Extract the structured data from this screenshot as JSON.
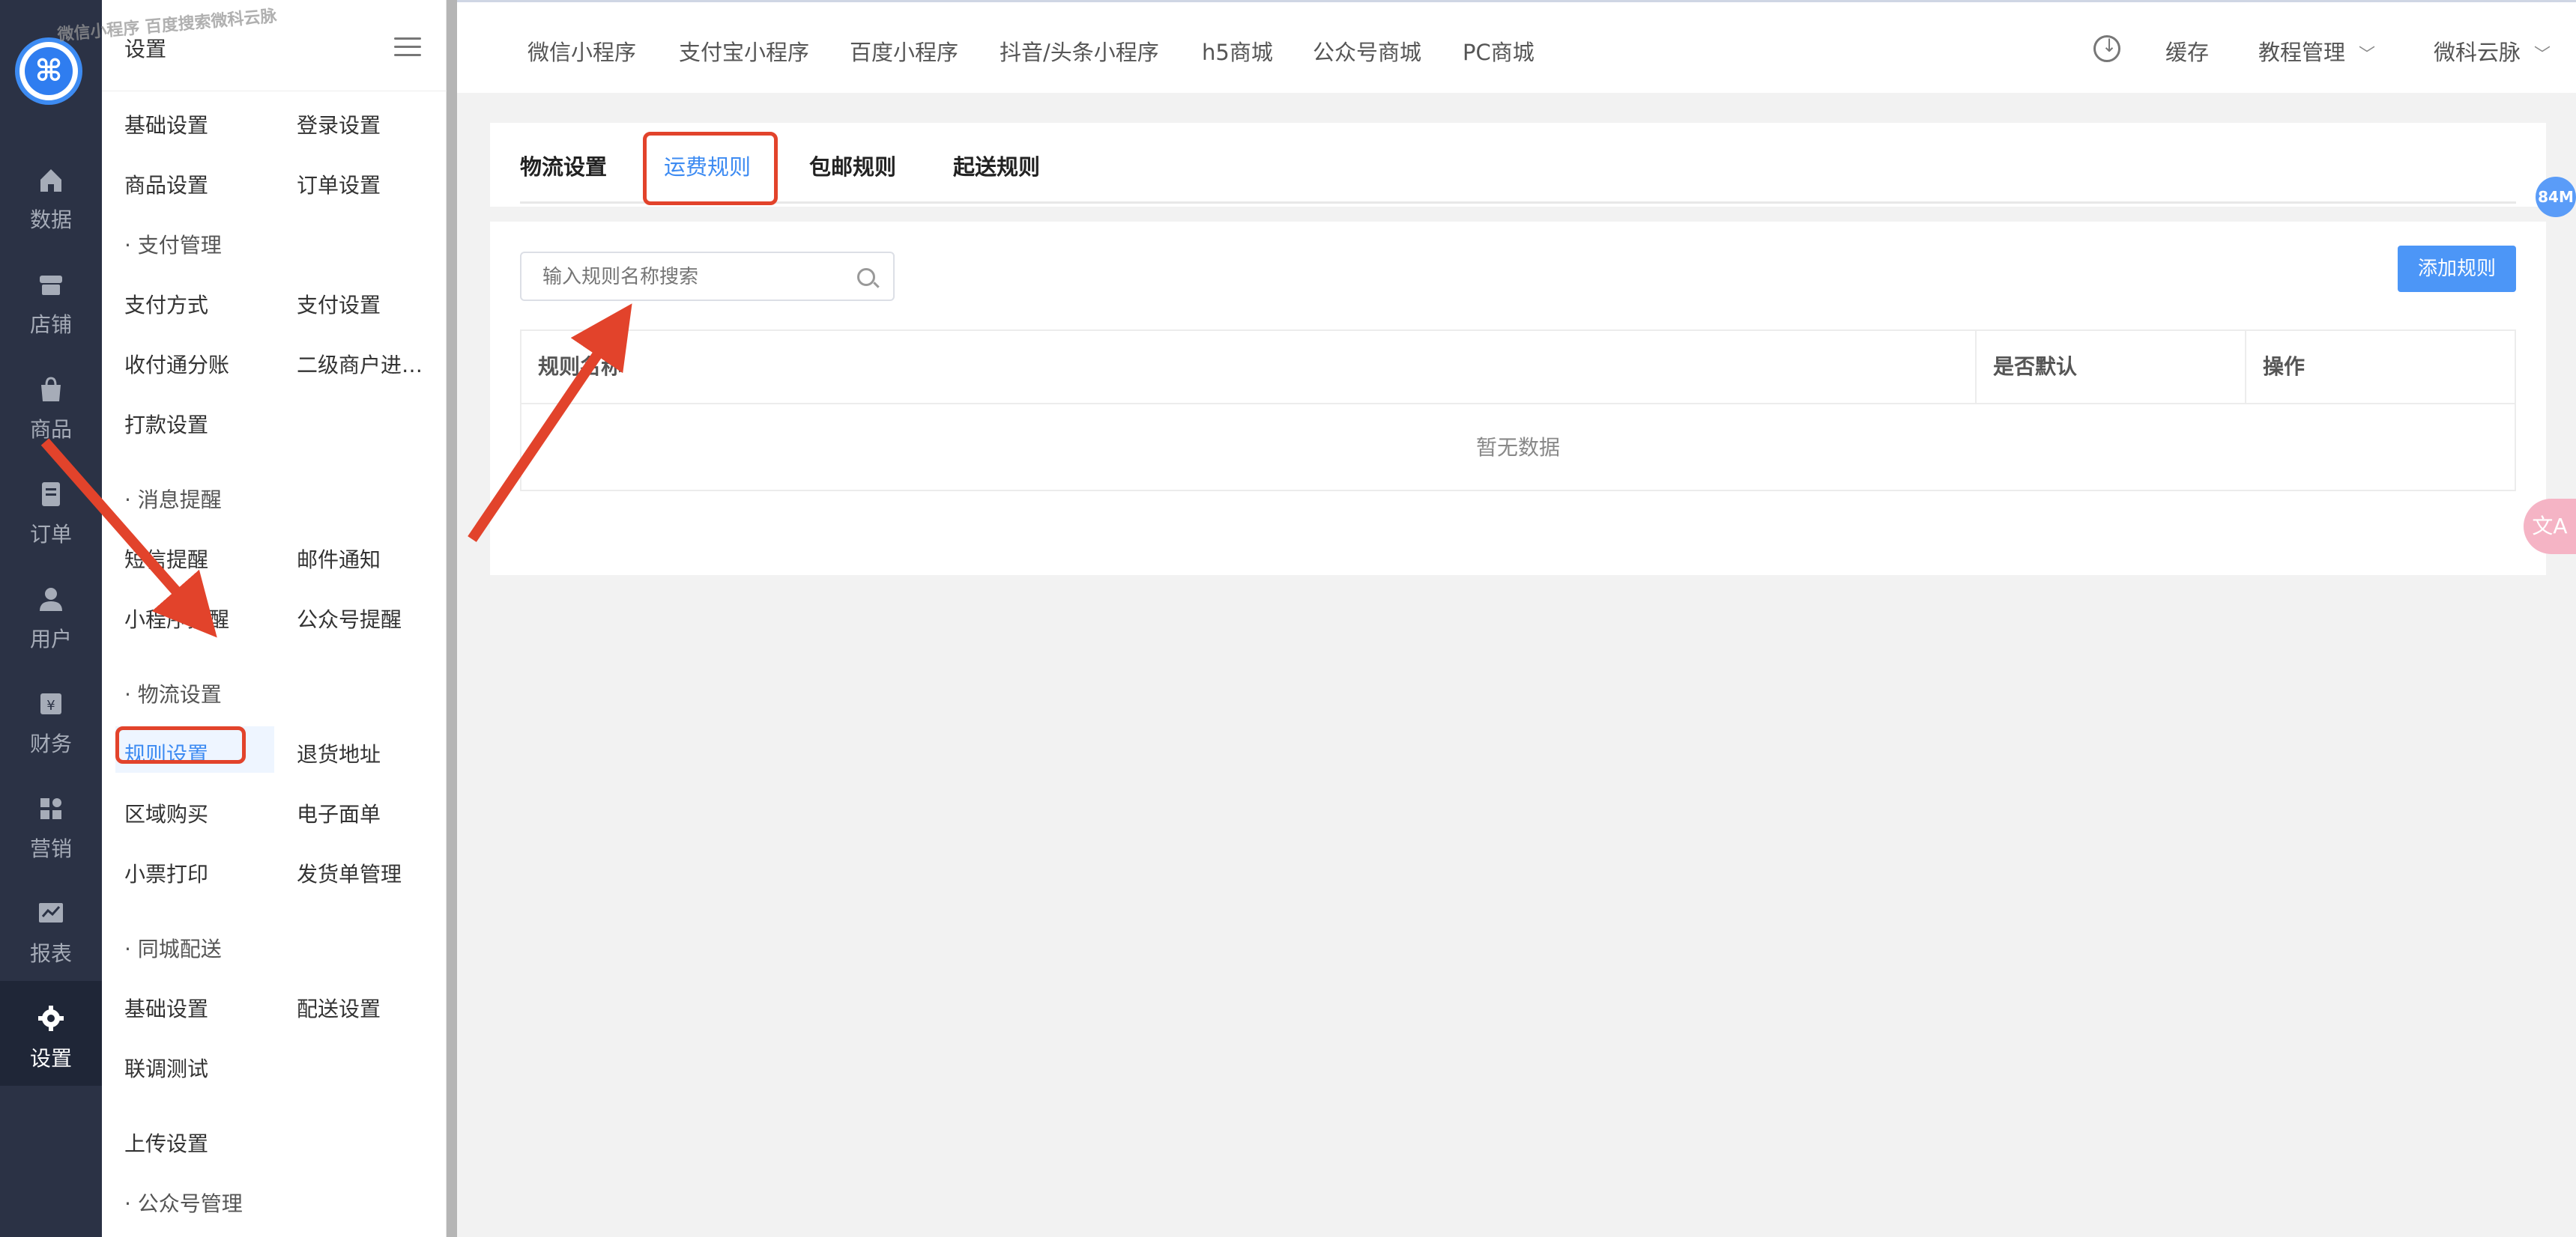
{
  "rail": {
    "logo": "⌘",
    "items": [
      {
        "label": "数据",
        "icon": "home-icon"
      },
      {
        "label": "店铺",
        "icon": "store-icon"
      },
      {
        "label": "商品",
        "icon": "bag-icon"
      },
      {
        "label": "订单",
        "icon": "order-icon"
      },
      {
        "label": "用户",
        "icon": "user-icon"
      },
      {
        "label": "财务",
        "icon": "finance-icon"
      },
      {
        "label": "营销",
        "icon": "marketing-icon"
      },
      {
        "label": "报表",
        "icon": "chart-icon"
      },
      {
        "label": "设置",
        "icon": "gear-icon"
      }
    ]
  },
  "submenu": {
    "title": "设置",
    "watermark": "微信小程序 百度搜索微科云脉",
    "items": {
      "basic": "基础设置",
      "login": "登录设置",
      "goods": "商品设置",
      "order": "订单设置",
      "pay_section": "· 支付管理",
      "pay_method": "支付方式",
      "pay_setting": "支付设置",
      "split": "收付通分账",
      "sub_merchant": "二级商户进…",
      "payout": "打款设置",
      "msg_section": "· 消息提醒",
      "sms": "短信提醒",
      "email": "邮件通知",
      "mini_msg": "小程序提醒",
      "mp_msg": "公众号提醒",
      "logistics_section": "· 物流设置",
      "rules": "规则设置",
      "return_addr": "退货地址",
      "region": "区域购买",
      "eorder": "电子面单",
      "receipt": "小票打印",
      "shipping": "发货单管理",
      "city_section": "· 同城配送",
      "city_basic": "基础设置",
      "delivery": "配送设置",
      "debug": "联调测试",
      "upload": "上传设置",
      "mp_section": "· 公众号管理"
    }
  },
  "topnav": {
    "tabs": [
      "微信小程序",
      "支付宝小程序",
      "百度小程序",
      "抖音/头条小程序",
      "h5商城",
      "公众号商城",
      "PC商城"
    ],
    "cache": "缓存",
    "tutorial": "教程管理",
    "user": "微科云脉"
  },
  "content": {
    "tabs": [
      "物流设置",
      "运费规则",
      "包邮规则",
      "起送规则"
    ],
    "active_tab": "运费规则",
    "search_placeholder": "输入规则名称搜索",
    "add_button": "添加规则",
    "columns": [
      "规则名称",
      "是否默认",
      "操作"
    ],
    "empty_text": "暂无数据"
  },
  "floating": {
    "memory_badge": "84M",
    "translate": "文A"
  },
  "colors": {
    "accent": "#3d8bf2",
    "rail_bg": "#2b3245",
    "annotation": "#e2432b"
  }
}
